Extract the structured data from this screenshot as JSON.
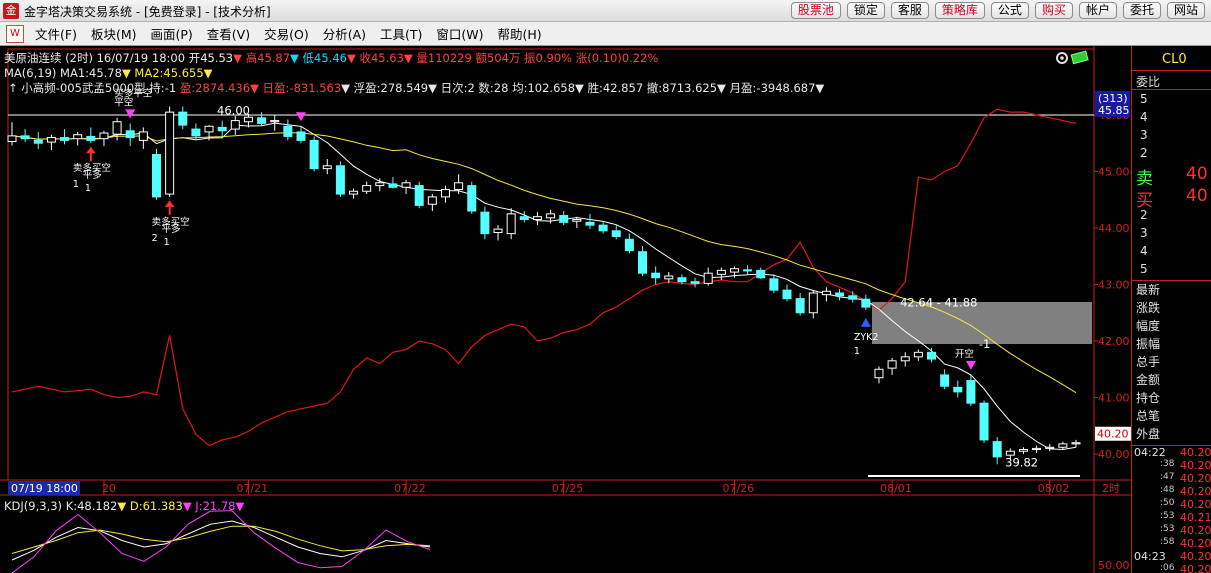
{
  "window": {
    "app_icon": "金",
    "title": "金字塔决策交易系统 - [免费登录] - [技术分析]",
    "buttons": [
      {
        "label": "股票池",
        "red": true
      },
      {
        "label": "锁定",
        "red": false
      },
      {
        "label": "客服",
        "red": false
      },
      {
        "label": "策略库",
        "red": true
      },
      {
        "label": "公式",
        "red": false
      },
      {
        "label": "购买",
        "red": true
      },
      {
        "label": "帐户",
        "red": false
      },
      {
        "label": "委托",
        "red": false
      },
      {
        "label": "网站",
        "red": false
      }
    ]
  },
  "menu": {
    "logo": "W",
    "items": [
      "文件(F)",
      "板块(M)",
      "画面(P)",
      "查看(V)",
      "交易(O)",
      "分析(A)",
      "工具(T)",
      "窗口(W)",
      "帮助(H)"
    ]
  },
  "header": {
    "line1": [
      {
        "text": "美原油连续 (2时) 16/07/19 18:00 开45.53",
        "color": "#e8e8e8"
      },
      {
        "text": "▼ 高45.87",
        "color": "#ff4040"
      },
      {
        "text": "▼ 低45.46",
        "color": "#00e0ff"
      },
      {
        "text": "▼ 收45.63",
        "color": "#ff4040"
      },
      {
        "text": "▼ 量110229 额504万 振0.90% 涨(0.10)0.22%",
        "color": "#ff4040"
      }
    ],
    "line2": [
      {
        "text": "MA(6,19) ",
        "color": "#e8e8e8"
      },
      {
        "text": "MA1:45.78",
        "color": "#e8e8e8"
      },
      {
        "text": "▼ MA2:45.655",
        "color": "#ffeb3b"
      },
      {
        "text": "▼",
        "color": "#ffeb3b"
      }
    ],
    "line3": [
      {
        "text": "↑ 小高频-005武孟5000型 持:-1 ",
        "color": "#e8e8e8"
      },
      {
        "text": "盈:2874.436",
        "color": "#ff4040"
      },
      {
        "text": "▼ 日盈:-831.563",
        "color": "#ff4040"
      },
      {
        "text": "▼ 浮盈:278.549▼ 日次:2 数:28 均:102.658▼ 胜:42.857 撤:8713.625▼ 月盈:-3948.687▼",
        "color": "#e8e8e8"
      }
    ],
    "kdj": [
      {
        "text": "KDJ(9,3,3) ",
        "color": "#e8e8e8"
      },
      {
        "text": "K:48.182",
        "color": "#e8e8e8"
      },
      {
        "text": "▼ D:61.383",
        "color": "#ffeb3b"
      },
      {
        "text": "▼ J:21.78",
        "color": "#ff40ff"
      },
      {
        "text": "▼",
        "color": "#ff40ff"
      }
    ]
  },
  "chart_data": {
    "type": "candlestick",
    "symbol": "美原油连续",
    "period": "2时",
    "ylim": [
      39.7,
      46.3
    ],
    "y_ticks": [
      "46.00",
      "45.00",
      "44.00",
      "43.00",
      "42.00",
      "41.00",
      "40.00"
    ],
    "date_labels": [
      {
        "label": "20",
        "index": 7
      },
      {
        "label": "07/21",
        "index": 18
      },
      {
        "label": "07/22",
        "index": 30
      },
      {
        "label": "07/25",
        "index": 42
      },
      {
        "label": "07/26",
        "index": 55
      },
      {
        "label": "08/01",
        "index": 67
      },
      {
        "label": "08/02",
        "index": 79
      }
    ],
    "cursor_date": "07/19 18:00",
    "period_label": "2时",
    "candles": [
      [
        45.53,
        45.87,
        45.46,
        45.63
      ],
      [
        45.63,
        45.75,
        45.52,
        45.58
      ],
      [
        45.55,
        45.7,
        45.4,
        45.5
      ],
      [
        45.52,
        45.65,
        45.38,
        45.6
      ],
      [
        45.6,
        45.75,
        45.48,
        45.55
      ],
      [
        45.58,
        45.7,
        45.46,
        45.65
      ],
      [
        45.62,
        45.78,
        45.5,
        45.55
      ],
      [
        45.58,
        45.72,
        45.45,
        45.68
      ],
      [
        45.66,
        45.95,
        45.55,
        45.88
      ],
      [
        45.72,
        45.85,
        45.45,
        45.6
      ],
      [
        45.55,
        45.78,
        45.4,
        45.7
      ],
      [
        45.3,
        45.4,
        44.5,
        44.55
      ],
      [
        44.6,
        46.15,
        44.55,
        46.05
      ],
      [
        46.05,
        46.15,
        45.75,
        45.82
      ],
      [
        45.75,
        45.85,
        45.55,
        45.63
      ],
      [
        45.7,
        45.82,
        45.55,
        45.8
      ],
      [
        45.78,
        45.9,
        45.6,
        45.72
      ],
      [
        45.75,
        45.98,
        45.65,
        45.9
      ],
      [
        45.88,
        46.02,
        45.78,
        45.96
      ],
      [
        45.95,
        46.05,
        45.8,
        45.85
      ],
      [
        45.88,
        46.0,
        45.72,
        45.9
      ],
      [
        45.8,
        45.92,
        45.55,
        45.62
      ],
      [
        45.7,
        45.8,
        45.5,
        45.55
      ],
      [
        45.55,
        45.62,
        45.0,
        45.05
      ],
      [
        45.05,
        45.22,
        44.95,
        45.1
      ],
      [
        45.1,
        45.18,
        44.55,
        44.6
      ],
      [
        44.6,
        44.7,
        44.52,
        44.65
      ],
      [
        44.65,
        44.82,
        44.6,
        44.75
      ],
      [
        44.75,
        44.88,
        44.65,
        44.8
      ],
      [
        44.78,
        44.9,
        44.7,
        44.72
      ],
      [
        44.72,
        44.85,
        44.6,
        44.8
      ],
      [
        44.75,
        44.82,
        44.35,
        44.4
      ],
      [
        44.42,
        44.6,
        44.3,
        44.55
      ],
      [
        44.55,
        44.75,
        44.45,
        44.68
      ],
      [
        44.68,
        44.95,
        44.6,
        44.8
      ],
      [
        44.75,
        44.82,
        44.25,
        44.3
      ],
      [
        44.28,
        44.38,
        43.8,
        43.9
      ],
      [
        43.92,
        44.05,
        43.78,
        43.98
      ],
      [
        43.9,
        44.35,
        43.8,
        44.25
      ],
      [
        44.2,
        44.3,
        44.1,
        44.15
      ],
      [
        44.15,
        44.28,
        44.05,
        44.2
      ],
      [
        44.18,
        44.32,
        44.08,
        44.25
      ],
      [
        44.22,
        44.3,
        44.05,
        44.1
      ],
      [
        44.12,
        44.2,
        44.0,
        44.15
      ],
      [
        44.1,
        44.25,
        43.98,
        44.05
      ],
      [
        44.05,
        44.12,
        43.9,
        43.95
      ],
      [
        43.95,
        44.05,
        43.8,
        43.85
      ],
      [
        43.8,
        43.9,
        43.55,
        43.6
      ],
      [
        43.58,
        43.68,
        43.15,
        43.2
      ],
      [
        43.2,
        43.32,
        43.0,
        43.12
      ],
      [
        43.1,
        43.22,
        43.02,
        43.15
      ],
      [
        43.12,
        43.18,
        43.0,
        43.05
      ],
      [
        43.05,
        43.12,
        42.95,
        43.02
      ],
      [
        43.02,
        43.3,
        42.98,
        43.2
      ],
      [
        43.18,
        43.3,
        43.08,
        43.25
      ],
      [
        43.22,
        43.32,
        43.12,
        43.28
      ],
      [
        43.26,
        43.34,
        43.18,
        43.24
      ],
      [
        43.25,
        43.3,
        43.1,
        43.12
      ],
      [
        43.1,
        43.18,
        42.85,
        42.9
      ],
      [
        42.9,
        43.0,
        42.7,
        42.75
      ],
      [
        42.75,
        42.85,
        42.45,
        42.5
      ],
      [
        42.5,
        42.9,
        42.4,
        42.85
      ],
      [
        42.82,
        42.95,
        42.7,
        42.88
      ],
      [
        42.85,
        42.92,
        42.72,
        42.8
      ],
      [
        42.8,
        42.88,
        42.68,
        42.74
      ],
      [
        42.74,
        42.82,
        42.55,
        42.6
      ],
      [
        41.35,
        41.55,
        41.25,
        41.5
      ],
      [
        41.52,
        41.7,
        41.4,
        41.65
      ],
      [
        41.65,
        41.8,
        41.55,
        41.72
      ],
      [
        41.72,
        41.85,
        41.65,
        41.8
      ],
      [
        41.8,
        41.88,
        41.62,
        41.68
      ],
      [
        41.4,
        41.5,
        41.15,
        41.2
      ],
      [
        41.18,
        41.3,
        41.0,
        41.1
      ],
      [
        41.3,
        41.4,
        40.85,
        40.9
      ],
      [
        40.9,
        40.95,
        40.2,
        40.25
      ],
      [
        40.22,
        40.3,
        39.82,
        39.95
      ],
      [
        39.98,
        40.1,
        39.9,
        40.05
      ],
      [
        40.05,
        40.12,
        40.0,
        40.08
      ],
      [
        40.08,
        40.15,
        40.02,
        40.1
      ],
      [
        40.1,
        40.18,
        40.05,
        40.12
      ],
      [
        40.12,
        40.22,
        40.08,
        40.18
      ],
      [
        40.18,
        40.25,
        40.12,
        40.2
      ]
    ],
    "red_line": [
      41.1,
      41.15,
      41.2,
      41.15,
      41.1,
      41.12,
      41.15,
      41.05,
      41.0,
      41.02,
      41.1,
      41.05,
      42.1,
      40.8,
      40.35,
      40.15,
      40.25,
      40.3,
      40.4,
      40.55,
      40.65,
      40.75,
      40.8,
      40.85,
      40.9,
      41.1,
      41.5,
      41.7,
      41.6,
      41.8,
      41.85,
      42.0,
      41.95,
      41.85,
      41.6,
      41.9,
      42.1,
      42.2,
      42.3,
      42.25,
      42.0,
      42.05,
      42.15,
      42.2,
      42.3,
      42.5,
      42.6,
      42.75,
      42.9,
      43.0,
      43.05,
      43.02,
      43.0,
      43.05,
      43.08,
      43.05,
      43.05,
      43.2,
      43.35,
      43.45,
      43.75,
      43.3,
      43.05,
      42.95,
      42.85,
      42.7,
      42.55,
      42.75,
      43.05,
      44.9,
      44.85,
      45.0,
      45.1,
      45.5,
      45.95,
      46.1,
      46.05,
      46.05,
      46.0,
      45.95,
      45.9,
      45.85
    ],
    "annotations": [
      {
        "index": 15,
        "price": 46.08,
        "text": "46.00"
      },
      {
        "index": 67,
        "price": 42.68,
        "text": "42.64 - 41.88"
      },
      {
        "index": 75,
        "price": 39.85,
        "text": "39.82"
      },
      {
        "index": 73,
        "price": 41.95,
        "text": "-1"
      }
    ],
    "signals": [
      {
        "index": 6,
        "side": "buy",
        "texts": [
          "卖多买空",
          "平多",
          "1",
          "1"
        ]
      },
      {
        "index": 9,
        "side": "sell",
        "texts": [
          "平空",
          "买多平空"
        ]
      },
      {
        "index": 12,
        "side": "buy",
        "texts": [
          "卖多买空",
          "平多",
          "2",
          "1"
        ]
      },
      {
        "index": 22,
        "side": "sell",
        "texts": []
      },
      {
        "index": 65,
        "side": "buy-blue",
        "texts": [
          "ZYK2",
          "1"
        ]
      },
      {
        "index": 73,
        "side": "sell",
        "texts": [
          "开空"
        ]
      }
    ],
    "tags": {
      "last_price": "40.20",
      "top_count": "(313)",
      "top_price": "45.85"
    },
    "kdj_axis_label": "50.00"
  },
  "quote": {
    "symbol": "CL0",
    "weibi": "委比",
    "sell_levels": [
      "5",
      "4",
      "3",
      "2"
    ],
    "sell_label": "卖",
    "sell_price": "40",
    "buy_label": "买",
    "buy_price": "40",
    "buy_levels": [
      "2",
      "3",
      "4",
      "5"
    ],
    "stats": [
      "最新",
      "涨跌",
      "幅度",
      "振幅",
      "总手",
      "金额",
      "持仓",
      "总笔",
      "外盘"
    ],
    "ticks": [
      {
        "time": "04:22",
        "val": "40.20",
        "small": false
      },
      {
        "time": ":38",
        "val": "40.20",
        "small": true
      },
      {
        "time": ":47",
        "val": "40.20",
        "small": true
      },
      {
        "time": ":48",
        "val": "40.20",
        "small": true
      },
      {
        "time": ":50",
        "val": "40.20",
        "small": true
      },
      {
        "time": ":53",
        "val": "40.21",
        "small": true
      },
      {
        "time": ":53",
        "val": "40.20",
        "small": true
      },
      {
        "time": ":58",
        "val": "40.20",
        "small": true
      },
      {
        "time": "04:23",
        "val": "40.20",
        "small": false
      },
      {
        "time": ":06",
        "val": "40.20",
        "small": true
      }
    ]
  }
}
